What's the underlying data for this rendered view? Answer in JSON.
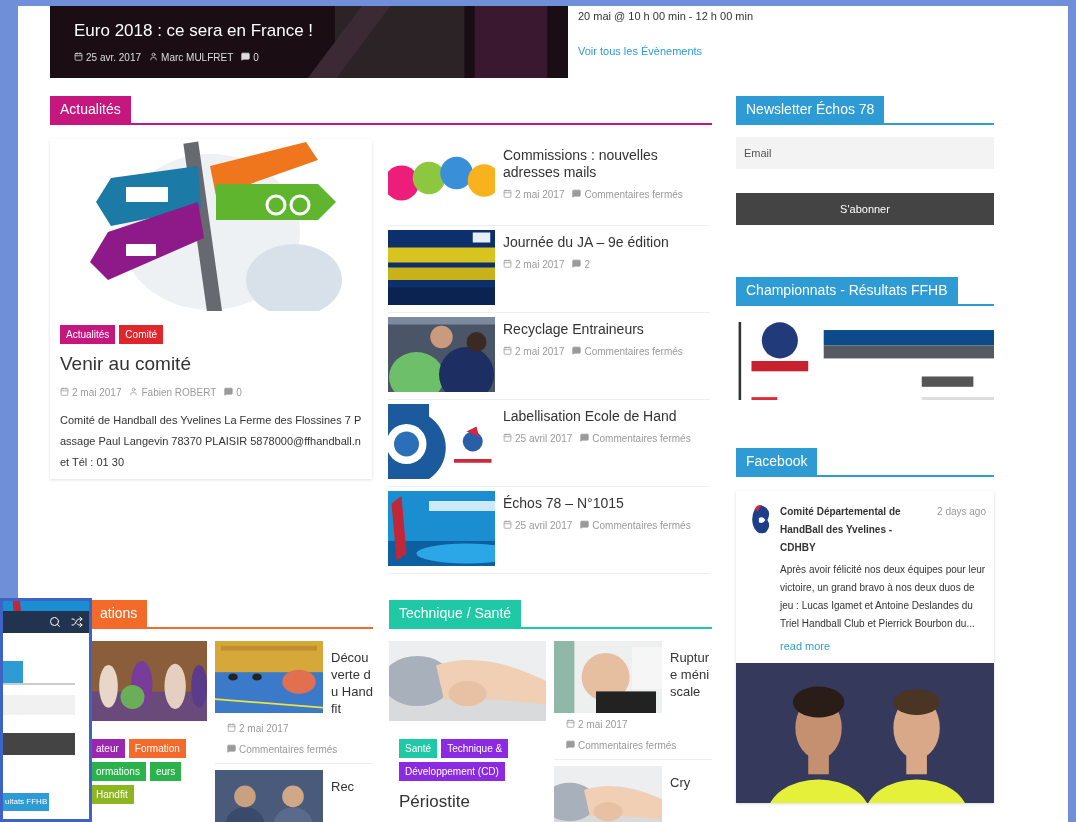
{
  "featured": {
    "title": "Euro 2018 : ce sera en France !",
    "meta": [
      {
        "kind": "date",
        "text": "25 avr. 2017"
      },
      {
        "kind": "author",
        "text": "Marc MULFRET"
      },
      {
        "kind": "comments",
        "text": "0"
      }
    ]
  },
  "event": {
    "time": "20 mai @ 10 h 00 min - 12 h 00 min",
    "link": "Voir tous les Évènements"
  },
  "actualites": {
    "title": "Actualités",
    "color": "#c6177e",
    "main": {
      "tags": [
        {
          "label": "Actualités",
          "color": "#c6177e"
        },
        {
          "label": "Comité",
          "color": "#e0262b"
        }
      ],
      "title": "Venir au comité",
      "meta": [
        {
          "kind": "date",
          "text": "2 mai 2017"
        },
        {
          "kind": "author",
          "text": "Fabien ROBERT"
        },
        {
          "kind": "comments",
          "text": "0"
        }
      ],
      "excerpt": "Comité de Handball des Yvelines La Ferme des Flossines 7 Passage Paul Langevin 78370 PLAISIR 5878000@ffhandball.net Tél : 01 30"
    },
    "list": [
      {
        "title": "Commissions : nouvelles adresses mails",
        "meta": [
          {
            "kind": "date",
            "text": "2 mai 2017"
          },
          {
            "kind": "comments",
            "text": "Commentaires fermés"
          }
        ]
      },
      {
        "title": "Journée du JA – 9e édition",
        "meta": [
          {
            "kind": "date",
            "text": "2 mai 2017"
          },
          {
            "kind": "comments",
            "text": "2"
          }
        ]
      },
      {
        "title": "Recyclage Entraineurs",
        "meta": [
          {
            "kind": "date",
            "text": "2 mai 2017"
          },
          {
            "kind": "comments",
            "text": "Commentaires fermés"
          }
        ]
      },
      {
        "title": "Labellisation Ecole de Hand",
        "meta": [
          {
            "kind": "date",
            "text": "25 avril 2017"
          },
          {
            "kind": "comments",
            "text": "Commentaires fermés"
          }
        ]
      },
      {
        "title": "Échos 78 – N°1015",
        "meta": [
          {
            "kind": "date",
            "text": "25 avril 2017"
          },
          {
            "kind": "comments",
            "text": "Commentaires fermés"
          }
        ]
      }
    ]
  },
  "lower_sections": [
    {
      "title": "ations",
      "color": "#f26b2a",
      "main": {
        "tags": [
          {
            "label": "ateur",
            "color": "#9b27b0"
          },
          {
            "label": "Formation",
            "color": "#f26b2a"
          },
          {
            "label": "ormations",
            "color": "#2bb24c"
          },
          {
            "label": "eurs",
            "color": "#2bb24c"
          },
          {
            "label": "Handfit",
            "color": "#8db51f"
          }
        ]
      },
      "side": [
        {
          "title": "Découverte du Handfit",
          "meta": [
            {
              "kind": "date",
              "text": "2 mai 2017"
            },
            {
              "kind": "comments",
              "text": "Commentaires fermés"
            }
          ]
        },
        {
          "title": "Rec"
        }
      ]
    },
    {
      "title": "Technique / Santé",
      "color": "#1fc9a5",
      "main": {
        "tags": [
          {
            "label": "Santé",
            "color": "#1fc9a5"
          },
          {
            "label": "Technique &",
            "color": "#8a2be2"
          },
          {
            "label": "Développement (CD)",
            "color": "#8a2be2"
          }
        ],
        "title": "Périostite"
      },
      "side": [
        {
          "title": "Rupture méniscale",
          "meta": [
            {
              "kind": "date",
              "text": "2 mai 2017"
            },
            {
              "kind": "comments",
              "text": "Commentaires fermés"
            }
          ]
        },
        {
          "title": "Cry"
        }
      ]
    }
  ],
  "sidebar": {
    "newsletter": {
      "title": "Newsletter Échos 78",
      "placeholder": "Email",
      "button": "S'abonner"
    },
    "championnats": {
      "title": "Championnats - Résultats FFHB"
    },
    "facebook": {
      "title": "Facebook",
      "page": "Comité Départemental de HandBall des Yvelines - CDHBY",
      "time": "2 days ago",
      "text": "Après avoir félicité nos deux équipes pour leur victoire, un grand bravo à nos deux duos de jeu : Lucas Igamet et Antoine Deslandes du Triel Handball Club et Pierrick Bourbon du...",
      "link": "read more"
    }
  },
  "overlay": {
    "tag": "ultats FFHB"
  }
}
